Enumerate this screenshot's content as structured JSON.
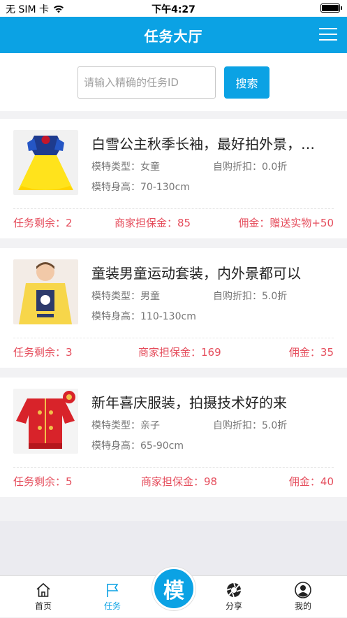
{
  "status_bar": {
    "carrier": "无 SIM 卡",
    "time": "下午4:27"
  },
  "header": {
    "title": "任务大厅"
  },
  "search": {
    "placeholder": "请输入精确的任务ID",
    "button_label": "搜索"
  },
  "tasks": [
    {
      "title": "白雪公主秋季长袖，最好拍外景，…",
      "model_type": "模特类型：女童",
      "discount": "自购折扣：0.0折",
      "height": "模特身高：70-130cm",
      "remaining": "任务剩余：2",
      "deposit": "商家担保金：85",
      "commission": "佣金：赠送实物+50"
    },
    {
      "title": "童装男童运动套装，内外景都可以",
      "model_type": "模特类型：男童",
      "discount": "自购折扣：5.0折",
      "height": "模特身高：110-130cm",
      "remaining": "任务剩余：3",
      "deposit": "商家担保金：169",
      "commission": "佣金：35"
    },
    {
      "title": "新年喜庆服装，拍摄技术好的来",
      "model_type": "模特类型：亲子",
      "discount": "自购折扣：5.0折",
      "height": "模特身高：65-90cm",
      "remaining": "任务剩余：5",
      "deposit": "商家担保金：98",
      "commission": "佣金：40"
    }
  ],
  "tabbar": {
    "items": [
      {
        "label": "首页",
        "icon": "home-icon"
      },
      {
        "label": "任务",
        "icon": "flag-icon"
      },
      {
        "label": "分享",
        "icon": "share-aperture-icon"
      },
      {
        "label": "我的",
        "icon": "user-icon"
      }
    ],
    "center_label": "模"
  },
  "colors": {
    "accent": "#0ba2e4",
    "price_red": "#e54d5c"
  }
}
